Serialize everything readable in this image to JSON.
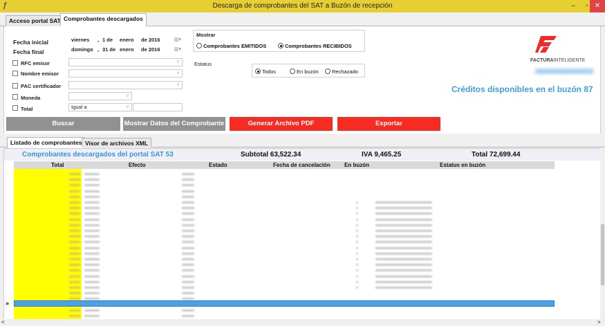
{
  "window": {
    "title": "Descarga de comprobantes del SAT a Buzón de recepción",
    "minimize": "–",
    "restore": "▫",
    "close": "✕"
  },
  "tabs": [
    {
      "label": "Acceso portal SAT"
    },
    {
      "label": "Comprobantes descargados"
    }
  ],
  "filters": {
    "fecha_inicial_label": "Fecha inicial",
    "fecha_final_label": "Fecha final",
    "fecha_inicial": {
      "weekday": "viernes",
      "day": "1 de",
      "month": "enero",
      "year": "de 2016"
    },
    "fecha_final": {
      "weekday": "domingo",
      "day": "31 de",
      "month": "enero",
      "year": "de 2016"
    },
    "rfc_emisor": "RFC emisor",
    "nombre_emisor": "Nombre emisor",
    "pac_certificador": "PAC certificador",
    "moneda": "Moneda",
    "total": "Total",
    "total_operator": "Igual a"
  },
  "mostrar": {
    "label": "Mostrar",
    "options": [
      {
        "label": "Comprobantes EMITIDOS",
        "checked": false
      },
      {
        "label": "Comprobantes RECIBIDOS",
        "checked": true
      }
    ]
  },
  "estatus": {
    "label": "Estatus",
    "options": [
      {
        "label": "Todos",
        "checked": true
      },
      {
        "label": "En buzón",
        "checked": false
      },
      {
        "label": "Rechazado",
        "checked": false
      }
    ]
  },
  "brand": {
    "name_bold": "FACTURA",
    "name_light": "INTELIGENTE"
  },
  "credits": "Créditos disponibles en el buzón 87",
  "buttons": {
    "buscar": "Buscar",
    "mostrar_datos": "Mostrar Datos del Comprobante",
    "generar_pdf": "Generar Archivo PDF",
    "exportar": "Exportar"
  },
  "lower_tabs": [
    {
      "label": "Listado de comprobantes"
    },
    {
      "label": "Visor de archivos XML"
    }
  ],
  "summary": {
    "descargados": "Comprobantes descargados del portal SAT 53",
    "subtotal": "Subtotal 63,522.34",
    "iva": "IVA 9,465.25",
    "total": "Total 72,699.44"
  },
  "columns": [
    "Total",
    "Efecto",
    "Estado",
    "Fecha de cancelación",
    "En buzón",
    "Estatus en buzón"
  ],
  "row_mark": "»",
  "scroll": {
    "left": "<",
    "right": ">",
    "up": "^"
  }
}
